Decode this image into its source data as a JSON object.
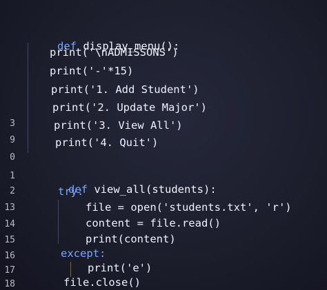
{
  "gutter": {
    "lines": [
      "3",
      "9",
      "0",
      "1",
      "2",
      "13",
      "14",
      "15",
      "16",
      "17",
      "18"
    ]
  },
  "code": {
    "def1": {
      "keyword": "def",
      "signature": "display_menu():"
    },
    "print1": "print('\\nADMISSONS')",
    "print2": "print('-'*15)",
    "print3": "print('1. Add Student')",
    "print4": "print('2. Update Major')",
    "print5": "print('3. View All')",
    "print6": "print('4. Quit')",
    "def2": {
      "keyword": "def",
      "signature": "view_all(students):"
    },
    "try": "try:",
    "file_open": "file = open('students.txt', 'r')",
    "content_read": "content = file.read()",
    "print_content": "print(content)",
    "except": "except:",
    "print_e": "print('e')",
    "file_close": "file.close()"
  },
  "colors": {
    "background": "#1b1d2b",
    "keyword": "#7aa6ff",
    "text": "#eef1ff",
    "line_number": "#b9bcc8"
  }
}
